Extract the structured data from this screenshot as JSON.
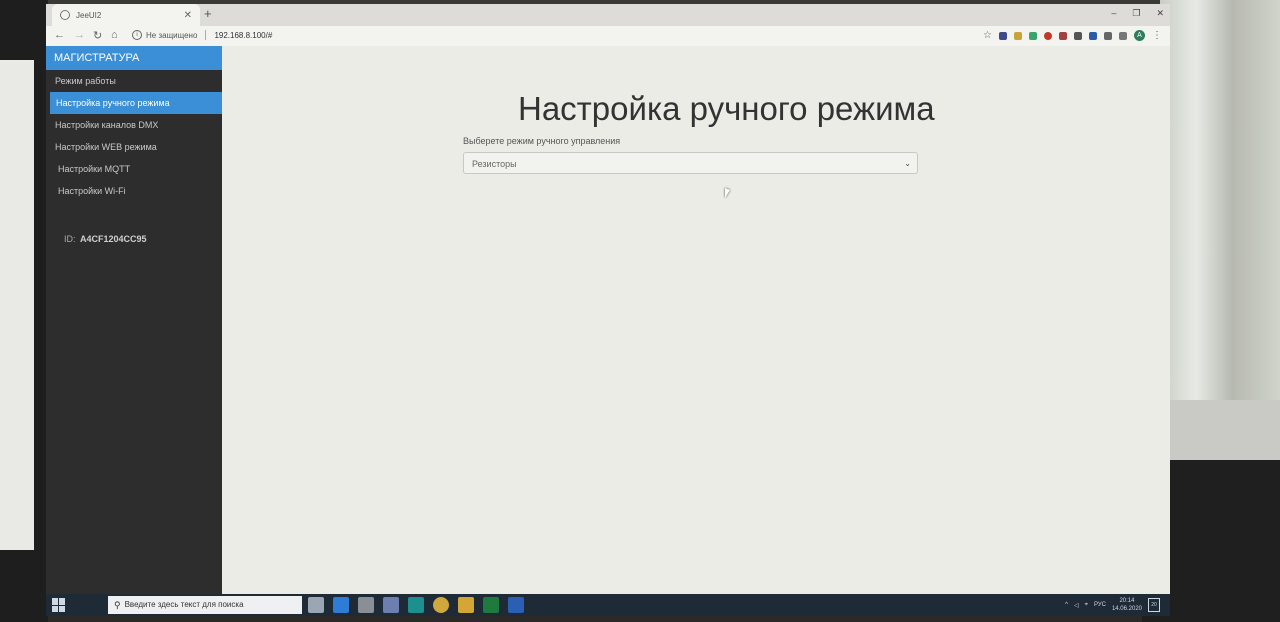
{
  "browser": {
    "tab_title": "JeeUI2",
    "tab_close": "✕",
    "new_tab": "+",
    "window_controls": [
      "–",
      "❐",
      "✕"
    ],
    "security_label": "Не защищено",
    "url": "192.168.8.100/#",
    "profile_initial": "A"
  },
  "sidebar": {
    "brand": "МАГИСТРАТУРА",
    "items": [
      {
        "label": "Режим работы",
        "active": false
      },
      {
        "label": "Настройка ручного режима",
        "active": true
      },
      {
        "label": "Настройки каналов DMX",
        "active": false
      },
      {
        "label": "Настройки WEB режима",
        "active": false
      },
      {
        "label": "Настройки MQTT",
        "active": false
      },
      {
        "label": "Настройки Wi-Fi",
        "active": false
      }
    ],
    "id_label": "ID:",
    "id_value": "A4CF1204CC95"
  },
  "main": {
    "title": "Настройка ручного режима",
    "select_label": "Выберете режим ручного управления",
    "select_value": "Резисторы"
  },
  "taskbar": {
    "search_placeholder": "Введите здесь текст для поиска",
    "language": "РУС",
    "time": "20:14",
    "date": "14.06.2020",
    "notifications": "20"
  },
  "colors": {
    "accent": "#3a8fd6",
    "sidebar_bg": "#2d2d2d",
    "page_bg": "#ecece7"
  }
}
